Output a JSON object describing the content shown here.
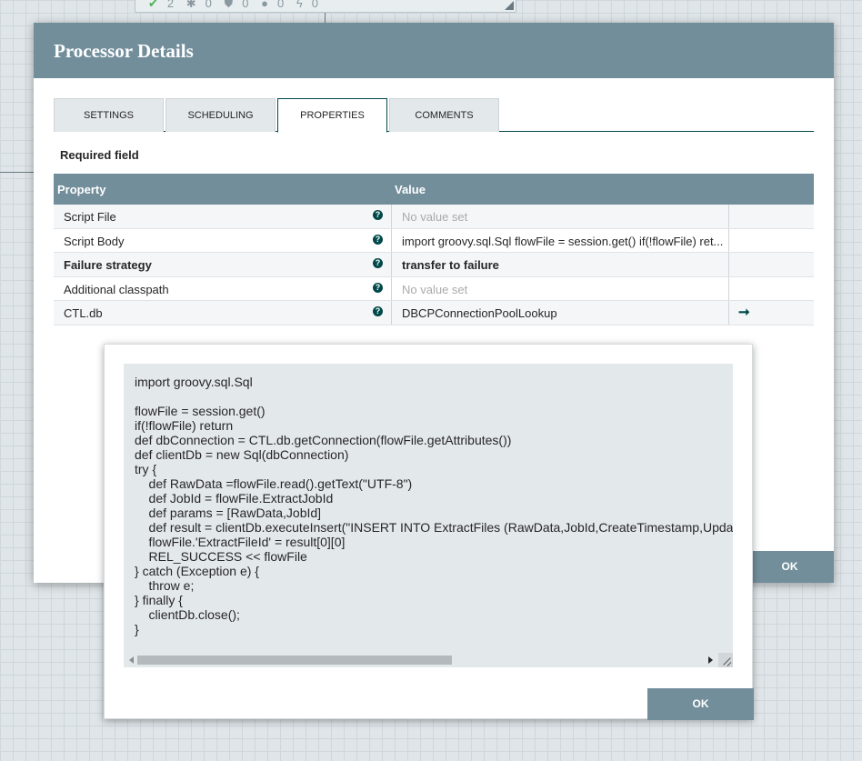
{
  "canvas": {
    "stats": [
      "2",
      "0",
      "0",
      "0",
      "0"
    ]
  },
  "dialog": {
    "title": "Processor Details",
    "tabs": [
      "SETTINGS",
      "SCHEDULING",
      "PROPERTIES",
      "COMMENTS"
    ],
    "active_tab": "PROPERTIES",
    "required_label": "Required field",
    "table": {
      "headers": [
        "Property",
        "Value"
      ],
      "rows": [
        {
          "name": "Script File",
          "value": "No value set",
          "required": false,
          "empty": true
        },
        {
          "name": "Script Body",
          "value": "import groovy.sql.Sql flowFile = session.get() if(!flowFile) ret...",
          "required": false,
          "empty": false
        },
        {
          "name": "Failure strategy",
          "value": "transfer to failure",
          "required": true,
          "empty": false
        },
        {
          "name": "Additional classpath",
          "value": "No value set",
          "required": false,
          "empty": true
        },
        {
          "name": "CTL.db",
          "value": "DBCPConnectionPoolLookup",
          "required": false,
          "empty": false,
          "has_goto": true
        }
      ],
      "help_glyph": "?",
      "goto_glyph": "➞"
    },
    "ok_label": "OK"
  },
  "popup": {
    "code": "import groovy.sql.Sql\n\nflowFile = session.get()\nif(!flowFile) return\ndef dbConnection = CTL.db.getConnection(flowFile.getAttributes())\ndef clientDb = new Sql(dbConnection)\ntry {\n    def RawData =flowFile.read().getText(\"UTF-8\")\n    def JobId = flowFile.ExtractJobId\n    def params = [RawData,JobId]\n    def result = clientDb.executeInsert(\"INSERT INTO ExtractFiles (RawData,JobId,CreateTimestamp,Upda\n    flowFile.'ExtractFileId' = result[0][0]\n    REL_SUCCESS << flowFile\n} catch (Exception e) {\n    throw e;\n} finally {\n    clientDb.close();\n}",
    "ok_label": "OK"
  }
}
